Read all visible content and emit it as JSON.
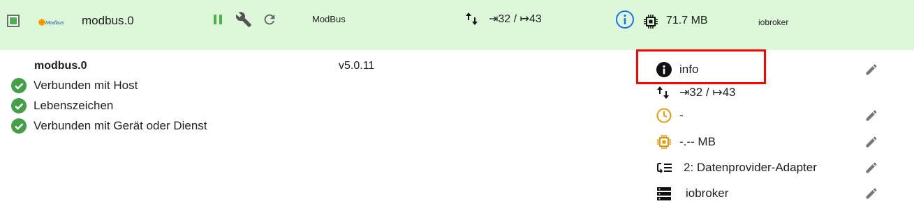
{
  "header": {
    "logo_text": "Modbus",
    "instance_name": "modbus.0",
    "mode": "ModBus",
    "connections": "⇥32 / ↦43",
    "memory": "71.7 MB",
    "host": "iobroker"
  },
  "details": {
    "name": "modbus.0",
    "version": "v5.0.11",
    "status": [
      {
        "label": "Verbunden mit Host"
      },
      {
        "label": "Lebenszeichen"
      },
      {
        "label": "Verbunden mit Gerät oder Dienst"
      }
    ]
  },
  "info_panel": {
    "info": "info",
    "connections": "⇥32 / ↦43",
    "schedule": "-",
    "memory": "-.-- MB",
    "tier": "2: Datenprovider-Adapter",
    "host": "iobroker"
  },
  "colors": {
    "header_bg": "#dcf8d9",
    "ok_green": "#43a047",
    "info_blue": "#1a73e8",
    "orange": "#e69a0a",
    "highlight_red": "#ff0000"
  }
}
